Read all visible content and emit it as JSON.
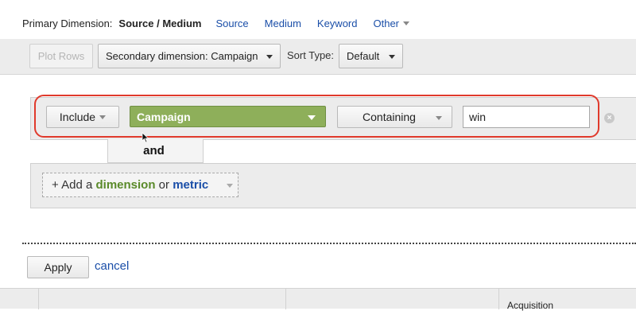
{
  "primary_dimension": {
    "label": "Primary Dimension:",
    "active": "Source / Medium",
    "links": [
      "Source",
      "Medium",
      "Keyword"
    ],
    "other": "Other"
  },
  "toolbar": {
    "plot_rows": "Plot Rows",
    "secondary_dimension": "Secondary dimension: Campaign",
    "sort_type_label": "Sort Type:",
    "sort_type_value": "Default"
  },
  "filter": {
    "include": "Include",
    "dimension": "Campaign",
    "match_type": "Containing",
    "value": "win",
    "clear_symbol": "×",
    "and_label": "and"
  },
  "add_filter": {
    "prefix": "+ Add a",
    "dimension_word": "dimension",
    "or_word": "or",
    "metric_word": "metric"
  },
  "actions": {
    "apply": "Apply",
    "cancel": "cancel"
  },
  "table": {
    "partial_header": "Acquisition"
  },
  "colors": {
    "link": "#1a4ea8",
    "campaign_green": "#8eaf5a",
    "highlight_red": "#e03a2c"
  }
}
